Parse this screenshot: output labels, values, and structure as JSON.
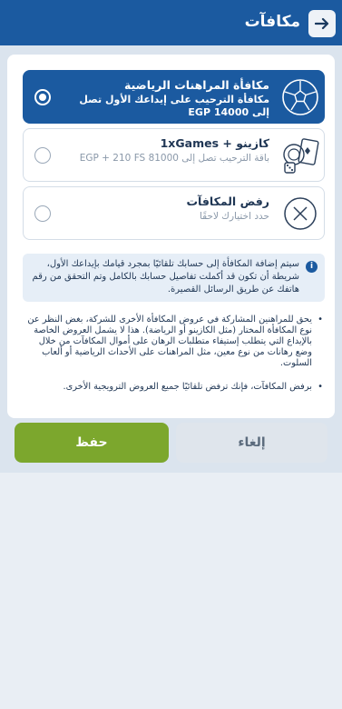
{
  "header": {
    "title": "مكافآت",
    "back_icon": "arrow-right-icon"
  },
  "options": [
    {
      "title": "مكافأة المراهنات الرياضية",
      "subtitle": "مكافأة الترحيب على إيداعك الأول تصل إلى 14000 EGP",
      "icon": "football-icon",
      "selected": true
    },
    {
      "title": "كازينو + 1xGames",
      "subtitle": "باقة الترحيب تصل إلى 81000 EGP + 210 FS",
      "icon": "casino-chips-icon",
      "selected": false
    },
    {
      "title": "رفض المكافآت",
      "subtitle": "حدد اختيارك لاحقًا",
      "icon": "close-circle-icon",
      "selected": false
    }
  ],
  "info": {
    "text": "سيتم إضافة المكافأة إلى حسابك تلقائيًا بمجرد قيامك بإيداعك الأول، شريطة أن تكون قد أكملت تفاصيل حسابك بالكامل وتم التحقق من رقم هاتفك عن طريق الرسائل القصيرة."
  },
  "bullets": [
    "يحق للمراهنين المشاركة في عروض المكافأة الأخرى للشركة، بغض النظر عن نوع المكافأة المختار (مثل الكازينو أو الرياضة). هذا لا يشمل العروض الخاصة بالإيداع التي يتطلب إستيفاء متطلبات الرهان على أموال المكافآت من خلال وضع رهانات من نوع معين، مثل المراهنات على الأحداث الرياضية أو ألعاب السلوت.",
    "برفض المكافآت، فإنك ترفض تلقائيًا جميع العروض الترويجية الأخرى."
  ],
  "buttons": {
    "cancel": "إلغاء",
    "save": "حفظ"
  },
  "colors": {
    "brand": "#1b5aa0",
    "save": "#7ca72d"
  }
}
